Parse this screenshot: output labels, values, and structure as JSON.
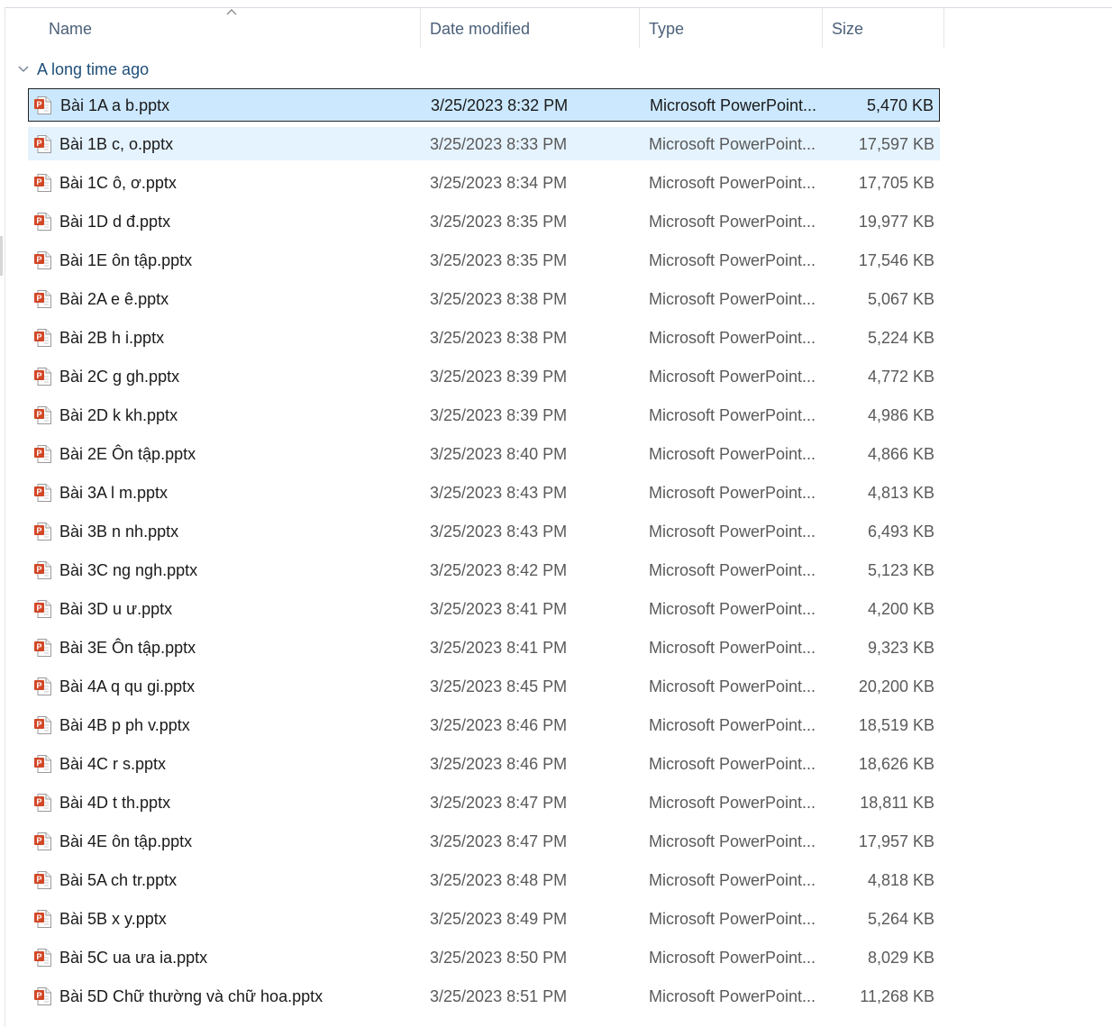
{
  "columns": {
    "name": "Name",
    "date": "Date modified",
    "type": "Type",
    "size": "Size"
  },
  "group": {
    "label": "A long time ago"
  },
  "colors": {
    "selected_bg": "#cce8ff",
    "hover_bg": "#e5f3ff",
    "ppt_orange": "#d24726"
  },
  "icons": {
    "file": "powerpoint-file-icon",
    "group": "chevron-down-icon",
    "sort": "sort-up-icon"
  },
  "files": [
    {
      "name": "Bài 1A a b.pptx",
      "date": "3/25/2023 8:32 PM",
      "type": "Microsoft PowerPoint...",
      "size": "5,470 KB"
    },
    {
      "name": "Bài 1B c, o.pptx",
      "date": "3/25/2023 8:33 PM",
      "type": "Microsoft PowerPoint...",
      "size": "17,597 KB"
    },
    {
      "name": "Bài 1C ô, ơ.pptx",
      "date": "3/25/2023 8:34 PM",
      "type": "Microsoft PowerPoint...",
      "size": "17,705 KB"
    },
    {
      "name": "Bài 1D d đ.pptx",
      "date": "3/25/2023 8:35 PM",
      "type": "Microsoft PowerPoint...",
      "size": "19,977 KB"
    },
    {
      "name": "Bài 1E ôn tập.pptx",
      "date": "3/25/2023 8:35 PM",
      "type": "Microsoft PowerPoint...",
      "size": "17,546 KB"
    },
    {
      "name": "Bài 2A e ê.pptx",
      "date": "3/25/2023 8:38 PM",
      "type": "Microsoft PowerPoint...",
      "size": "5,067 KB"
    },
    {
      "name": "Bài 2B h i.pptx",
      "date": "3/25/2023 8:38 PM",
      "type": "Microsoft PowerPoint...",
      "size": "5,224 KB"
    },
    {
      "name": "Bài 2C g gh.pptx",
      "date": "3/25/2023 8:39 PM",
      "type": "Microsoft PowerPoint...",
      "size": "4,772 KB"
    },
    {
      "name": "Bài 2D k kh.pptx",
      "date": "3/25/2023 8:39 PM",
      "type": "Microsoft PowerPoint...",
      "size": "4,986 KB"
    },
    {
      "name": "Bài 2E Ôn tập.pptx",
      "date": "3/25/2023 8:40 PM",
      "type": "Microsoft PowerPoint...",
      "size": "4,866 KB"
    },
    {
      "name": "Bài 3A l m.pptx",
      "date": "3/25/2023 8:43 PM",
      "type": "Microsoft PowerPoint...",
      "size": "4,813 KB"
    },
    {
      "name": "Bài 3B n nh.pptx",
      "date": "3/25/2023 8:43 PM",
      "type": "Microsoft PowerPoint...",
      "size": "6,493 KB"
    },
    {
      "name": "Bài 3C ng ngh.pptx",
      "date": "3/25/2023 8:42 PM",
      "type": "Microsoft PowerPoint...",
      "size": "5,123 KB"
    },
    {
      "name": "Bài 3D u ư.pptx",
      "date": "3/25/2023 8:41 PM",
      "type": "Microsoft PowerPoint...",
      "size": "4,200 KB"
    },
    {
      "name": "Bài 3E Ôn tập.pptx",
      "date": "3/25/2023 8:41 PM",
      "type": "Microsoft PowerPoint...",
      "size": "9,323 KB"
    },
    {
      "name": "Bài 4A q qu gi.pptx",
      "date": "3/25/2023 8:45 PM",
      "type": "Microsoft PowerPoint...",
      "size": "20,200 KB"
    },
    {
      "name": "Bài 4B p ph v.pptx",
      "date": "3/25/2023 8:46 PM",
      "type": "Microsoft PowerPoint...",
      "size": "18,519 KB"
    },
    {
      "name": "Bài 4C r s.pptx",
      "date": "3/25/2023 8:46 PM",
      "type": "Microsoft PowerPoint...",
      "size": "18,626 KB"
    },
    {
      "name": "Bài 4D t th.pptx",
      "date": "3/25/2023 8:47 PM",
      "type": "Microsoft PowerPoint...",
      "size": "18,811 KB"
    },
    {
      "name": "Bài 4E ôn tập.pptx",
      "date": "3/25/2023 8:47 PM",
      "type": "Microsoft PowerPoint...",
      "size": "17,957 KB"
    },
    {
      "name": "Bài 5A ch tr.pptx",
      "date": "3/25/2023 8:48 PM",
      "type": "Microsoft PowerPoint...",
      "size": "4,818 KB"
    },
    {
      "name": "Bài 5B x y.pptx",
      "date": "3/25/2023 8:49 PM",
      "type": "Microsoft PowerPoint...",
      "size": "5,264 KB"
    },
    {
      "name": "Bài 5C ua ưa ia.pptx",
      "date": "3/25/2023 8:50 PM",
      "type": "Microsoft PowerPoint...",
      "size": "8,029 KB"
    },
    {
      "name": "Bài 5D Chữ thường và chữ hoa.pptx",
      "date": "3/25/2023 8:51 PM",
      "type": "Microsoft PowerPoint...",
      "size": "11,268 KB"
    }
  ]
}
